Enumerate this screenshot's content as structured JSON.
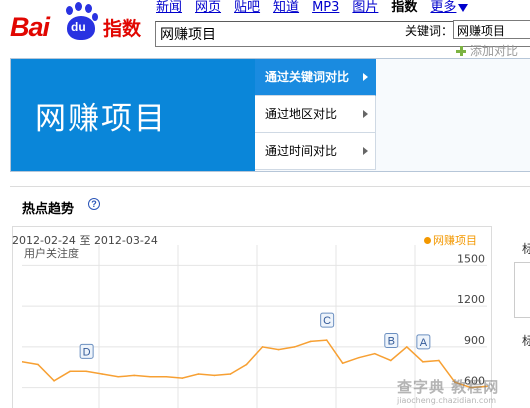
{
  "brand": {
    "bai": "Bai",
    "du": "du",
    "zhishu": "指数",
    "accent": "#e10601",
    "paw_color": "#2932e1"
  },
  "topnav": [
    {
      "label": "新闻",
      "current": false
    },
    {
      "label": "网页",
      "current": false
    },
    {
      "label": "贴吧",
      "current": false
    },
    {
      "label": "知道",
      "current": false
    },
    {
      "label": "MP3",
      "current": false
    },
    {
      "label": "图片",
      "current": false
    },
    {
      "label": "指数",
      "current": true
    },
    {
      "label": "更多",
      "current": false,
      "icon": "triangle-down-icon"
    }
  ],
  "search": {
    "value": "网赚项目"
  },
  "banner": {
    "keyword": "网赚项目",
    "panel_color": "#0a86d9",
    "tabs": [
      {
        "label": "通过关键词对比",
        "active": true
      },
      {
        "label": "通过地区对比",
        "active": false
      },
      {
        "label": "通过时间对比",
        "active": false
      }
    ],
    "keyword_label": "关键词：",
    "keyword_input": "网赚项目",
    "add_compare": "添加对比"
  },
  "hot_trend": {
    "title": "热点趋势",
    "help": "?",
    "date_from": "2012-02-24",
    "date_to_word": "至",
    "date_to": "2012-03-24",
    "legend": "网赚项目",
    "ylabel": "用户关注度"
  },
  "right_col": {
    "label1": "标",
    "label2": "标"
  },
  "chart_data": {
    "type": "line",
    "title": "",
    "xlabel": "",
    "ylabel": "用户关注度",
    "x": [
      "2012-02-24",
      "2012-02-25",
      "2012-02-26",
      "2012-02-27",
      "2012-02-28",
      "2012-02-29",
      "2012-03-01",
      "2012-03-02",
      "2012-03-03",
      "2012-03-04",
      "2012-03-05",
      "2012-03-06",
      "2012-03-07",
      "2012-03-08",
      "2012-03-09",
      "2012-03-10",
      "2012-03-11",
      "2012-03-12",
      "2012-03-13",
      "2012-03-14",
      "2012-03-15",
      "2012-03-16",
      "2012-03-17",
      "2012-03-18",
      "2012-03-19",
      "2012-03-20",
      "2012-03-21",
      "2012-03-22",
      "2012-03-23",
      "2012-03-24"
    ],
    "series": [
      {
        "name": "网赚项目",
        "color": "#f7a033",
        "values": [
          790,
          770,
          650,
          720,
          720,
          700,
          680,
          690,
          680,
          680,
          670,
          700,
          690,
          700,
          770,
          900,
          880,
          900,
          940,
          950,
          780,
          820,
          850,
          800,
          900,
          790,
          800,
          640,
          600,
          610
        ]
      }
    ],
    "yticks": [
      600,
      900,
      1200,
      1500
    ],
    "ylim": [
      450,
      1650
    ],
    "annotations": [
      {
        "letter": "D",
        "index": 4
      },
      {
        "letter": "C",
        "index": 19
      },
      {
        "letter": "B",
        "index": 23
      },
      {
        "letter": "A",
        "index": 25
      }
    ],
    "grid": true
  },
  "watermark": {
    "line1": "查字典 教程网",
    "line2": "jiaocheng.chazidian.com"
  }
}
